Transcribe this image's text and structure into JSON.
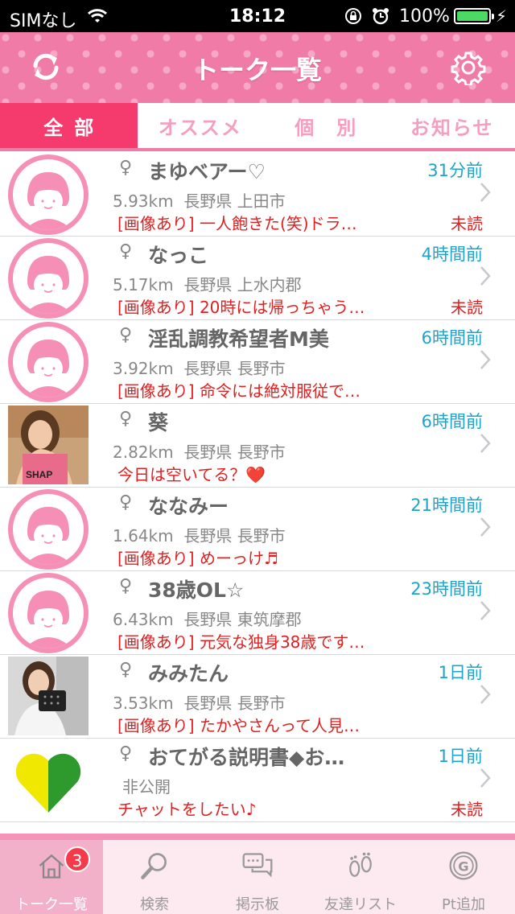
{
  "status": {
    "carrier": "SIMなし",
    "time": "18:12",
    "battery": "100%"
  },
  "header": {
    "title": "トーク一覧"
  },
  "tabs": [
    {
      "label": "全部",
      "active": true
    },
    {
      "label": "オススメ",
      "active": false
    },
    {
      "label": "個　別",
      "active": false
    },
    {
      "label": "お知らせ",
      "active": false
    }
  ],
  "rows": [
    {
      "gender": "♀",
      "name": "まゆベアー♡",
      "ago": "31分前",
      "distance": "5.93km",
      "location": "長野県 上田市",
      "message": "[画像あり] 一人飽きた(笑)ドラ…",
      "unread": "未読",
      "avatar": "default"
    },
    {
      "gender": "♀",
      "name": "なっこ",
      "ago": "4時間前",
      "distance": "5.17km",
      "location": "長野県 上水内郡",
      "message": "[画像あり] 20時には帰っちゃう…",
      "unread": "未読",
      "avatar": "default"
    },
    {
      "gender": "♀",
      "name": "淫乱調教希望者M美",
      "ago": "6時間前",
      "distance": "3.92km",
      "location": "長野県 長野市",
      "message": "[画像あり] 命令には絶対服従で…",
      "unread": "",
      "avatar": "default"
    },
    {
      "gender": "♀",
      "name": "葵",
      "ago": "6時間前",
      "distance": "2.82km",
      "location": "長野県 長野市",
      "message": "今日は空いてる？❤️",
      "unread": "",
      "avatar": "photo1"
    },
    {
      "gender": "♀",
      "name": "ななみー",
      "ago": "21時間前",
      "distance": "1.64km",
      "location": "長野県 長野市",
      "message": "[画像あり] めーっけ♬",
      "unread": "",
      "avatar": "default"
    },
    {
      "gender": "♀",
      "name": "38歳OL☆",
      "ago": "23時間前",
      "distance": "6.43km",
      "location": "長野県 東筑摩郡",
      "message": "[画像あり] 元気な独身38歳です…",
      "unread": "",
      "avatar": "default"
    },
    {
      "gender": "♀",
      "name": "みみたん",
      "ago": "1日前",
      "distance": "3.53km",
      "location": "長野県 長野市",
      "message": "[画像あり] たかやさんって人見…",
      "unread": "",
      "avatar": "photo2"
    },
    {
      "gender": "♀",
      "name": "おてがる説明書◆お…",
      "ago": "1日前",
      "distance": "",
      "location": "非公開",
      "message": "チャットをしたい♪",
      "unread": "未読",
      "avatar": "heart"
    }
  ],
  "tabbar": {
    "items": [
      {
        "label": "トーク一覧",
        "icon": "house-icon",
        "active": true,
        "badge": "3"
      },
      {
        "label": "検索",
        "icon": "magnifier-icon",
        "active": false
      },
      {
        "label": "掲示板",
        "icon": "chat-bubbles-icon",
        "active": false
      },
      {
        "label": "友達リスト",
        "icon": "footprints-icon",
        "active": false
      },
      {
        "label": "Pt追加",
        "icon": "g-coin-icon",
        "active": false
      }
    ]
  },
  "colors": {
    "pink": "#f07ba6",
    "active_tab": "#f53b6e",
    "time_blue": "#1ea3c9",
    "message_red": "#e02020"
  }
}
